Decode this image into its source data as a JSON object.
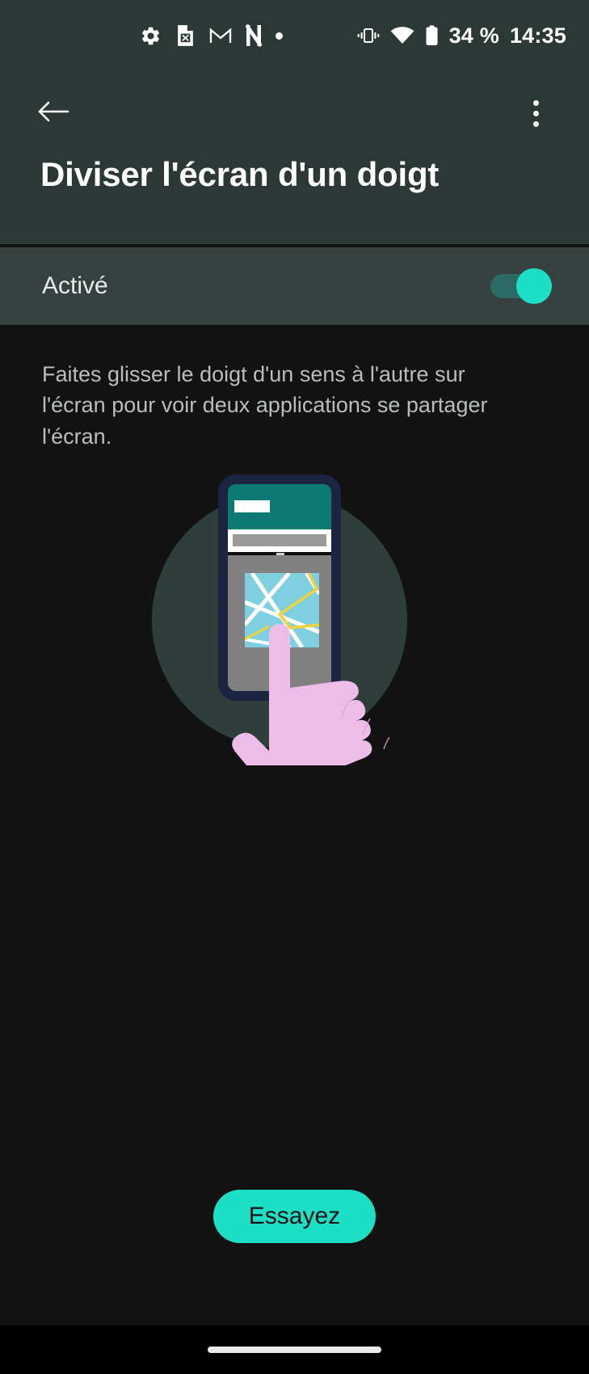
{
  "statusbar": {
    "left_icons": [
      {
        "name": "settings-gear-icon",
        "label": "Paramètres"
      },
      {
        "name": "spreadsheet-file-icon",
        "label": "Fichier tableur"
      },
      {
        "name": "gmail-icon",
        "label": "Gmail"
      },
      {
        "name": "netflix-icon",
        "label": "Netflix"
      },
      {
        "name": "more-notifications-dot-icon",
        "label": "Plus de notifications"
      }
    ],
    "right_icons": [
      {
        "name": "vibrate-icon",
        "label": "Mode vibreur"
      },
      {
        "name": "wifi-icon",
        "label": "Wi-Fi"
      },
      {
        "name": "battery-icon",
        "label": "Batterie"
      }
    ],
    "battery_level": "34 %",
    "clock": "14:35"
  },
  "appbar": {
    "back_icon": "back-arrow-icon",
    "overflow_icon": "more-vert-icon",
    "title": "Diviser l'écran d'un doigt"
  },
  "setting": {
    "label": "Activé",
    "enabled": true
  },
  "main": {
    "description": "Faites glisser le doigt d'un sens à l'autre sur l'écran pour voir deux applications se partager l'écran.",
    "illustration_name": "split-screen-swipe-illustration"
  },
  "cta": {
    "label": "Essayez"
  },
  "navbar": {
    "gesture_pill": "gesture-home-pill"
  },
  "colors": {
    "status_bar_bg": "#2b3836",
    "app_bar_bg": "#2b3836",
    "toggle_row_bg": "#37413f",
    "page_bg": "#121212",
    "accent": "#1ddfc6",
    "switch_track": "#2c6b64",
    "description_text": "#b9bdbc",
    "illustration_circle": "#2d3e3b",
    "phone_bezel": "#1b2440",
    "phone_header": "#0b7a73",
    "phone_body": "#808080",
    "map_bg": "#7ed0e0",
    "map_road": "#ffffff",
    "map_highway": "#f2d23c",
    "hand": "#eebce8"
  }
}
